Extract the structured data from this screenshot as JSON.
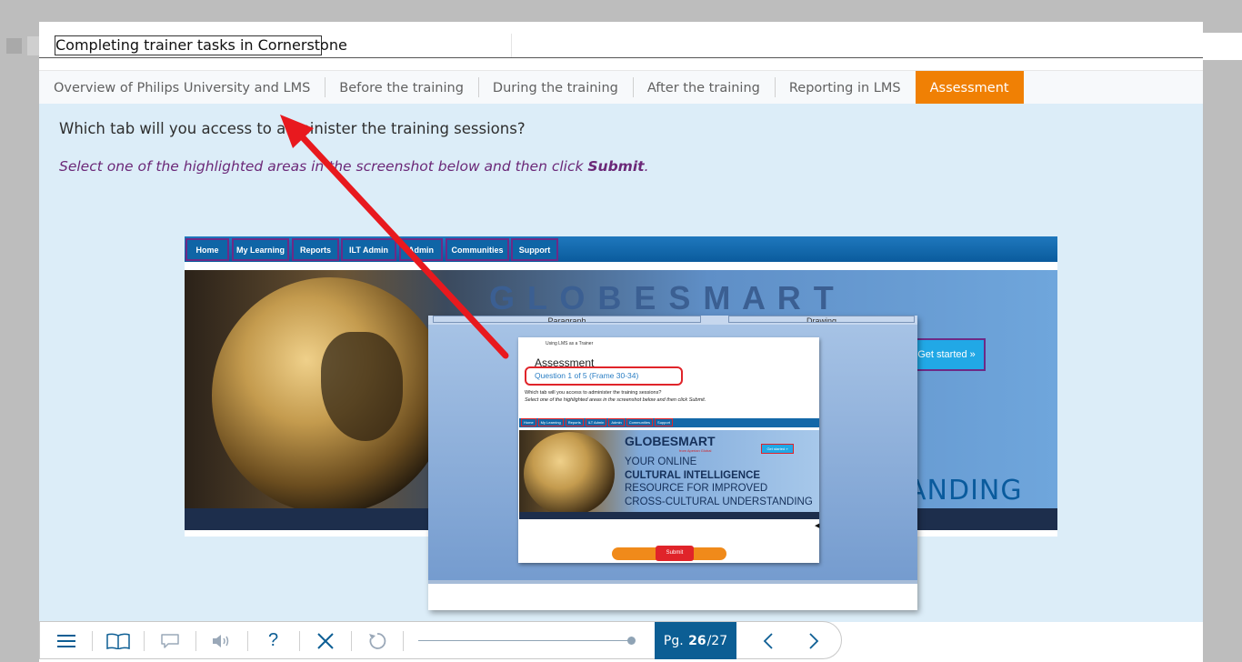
{
  "course": {
    "title": "Completing trainer tasks in Cornerstone"
  },
  "tabs": [
    {
      "label": "Overview of Philips University and LMS"
    },
    {
      "label": "Before the training"
    },
    {
      "label": "During the training"
    },
    {
      "label": "After the training"
    },
    {
      "label": "Reporting in LMS"
    },
    {
      "label": "Assessment",
      "active": true
    }
  ],
  "question": {
    "text": "Which tab will you access to administer the training sessions?",
    "instruction_prefix": "Select one of the highlighted areas in the screenshot below and then click ",
    "instruction_bold": "Submit",
    "instruction_suffix": "."
  },
  "screenshot": {
    "nav": [
      "Home",
      "My Learning",
      "Reports",
      "ILT Admin",
      "Admin",
      "Communities",
      "Support"
    ],
    "get_started": "Get started »",
    "banner_partial": "ANDING",
    "popup": {
      "tab_left": "Paragraph",
      "tab_right": "Drawing",
      "crumb": "Using LMS as a Trainer",
      "title": "Assessment",
      "question_label": "Question 1 of 5 (Frame 30-34)",
      "q_text": "Which tab will you access to administer the training sessions?",
      "q_instruction": "Select one of the highlighted areas in the screenshot below and then click Submit.",
      "nav": [
        "Home",
        "My Learning",
        "Reports",
        "ILT Admin",
        "Admin",
        "Communities",
        "Support"
      ],
      "brand": "GLOBESMART",
      "brand_sub": "from Aperian Global",
      "lines": [
        "YOUR ONLINE",
        "CULTURAL INTELLIGENCE",
        "RESOURCE FOR IMPROVED",
        "CROSS-CULTURAL UNDERSTANDING"
      ],
      "get_started": "Get started »",
      "submit": "Submit"
    }
  },
  "toolbar": {
    "page_prefix": "Pg.",
    "page_current": "26",
    "page_total": "/27",
    "progress": 0.96,
    "icons": [
      "menu-icon",
      "book-icon",
      "comment-icon",
      "audio-icon",
      "help-icon",
      "close-icon",
      "replay-icon",
      "prev-icon",
      "next-icon"
    ]
  },
  "colors": {
    "accent": "#f08004",
    "content_bg": "#dcedf8",
    "instruction": "#6b2878",
    "highlight": "#6d2a86",
    "arrow": "#e8191e"
  }
}
